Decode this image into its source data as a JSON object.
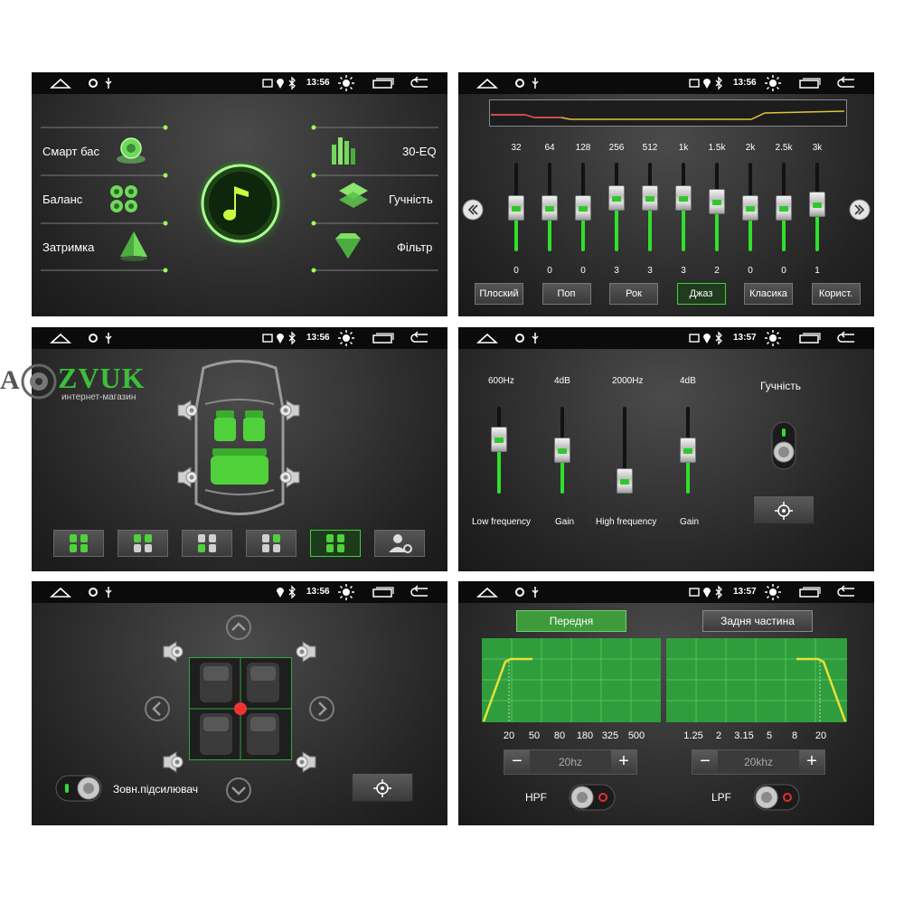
{
  "watermark": {
    "brand": "AVZVUK",
    "brand_prefix": "A",
    "brand_rest": "ZVUK",
    "subtitle": "интернет-магазин"
  },
  "status": {
    "p1_time": "13:56",
    "p2_time": "13:56",
    "p3_time": "13:56",
    "p4_time": "13:57",
    "p5_time": "13:56",
    "p6_time": "13:57"
  },
  "p1": {
    "smart_bass": "Смарт бас",
    "balance": "Баланс",
    "delay": "Затримка",
    "eq30": "30-EQ",
    "volume": "Гучність",
    "filter": "Фільтр"
  },
  "p2": {
    "bands": [
      "32",
      "64",
      "128",
      "256",
      "512",
      "1k",
      "1.5k",
      "2k",
      "2.5k",
      "3k"
    ],
    "values": [
      0,
      0,
      0,
      3,
      3,
      3,
      2,
      0,
      0,
      1
    ],
    "presets": [
      "Плоский",
      "Поп",
      "Рок",
      "Джаз",
      "Класика",
      "Корист."
    ],
    "active_preset": "Джаз",
    "prev_icon": "chevron-left-double-icon",
    "next_icon": "chevron-right-double-icon"
  },
  "p3": {
    "seat_modes": [
      "all-seats",
      "front-seats",
      "rear-left",
      "front-left",
      "driver",
      "custom"
    ],
    "active_mode": 4
  },
  "p4": {
    "freq1": "600Hz",
    "gain1": "4dB",
    "freq2": "2000Hz",
    "gain2": "4dB",
    "low_freq_label": "Low frequency",
    "gain_label_1": "Gain",
    "high_freq_label": "High frequency",
    "gain_label_2": "Gain",
    "volume_label": "Гучність",
    "levels": [
      0.62,
      0.5,
      0.12,
      0.5
    ]
  },
  "p5": {
    "subwoofer_label": "Зовн.підсилювач"
  },
  "p6": {
    "front_tab": "Передня",
    "rear_tab": "Задня частина",
    "hpf_ticks": [
      "20",
      "50",
      "80",
      "180",
      "325",
      "500"
    ],
    "lpf_ticks": [
      "1.25",
      "2",
      "3.15",
      "5",
      "8",
      "20"
    ],
    "hpf_value": "20hz",
    "lpf_value": "20khz",
    "minus": "−",
    "plus": "+",
    "hpf_label": "HPF",
    "lpf_label": "LPF"
  },
  "colors": {
    "accent": "#3fcf32",
    "active_border": "#3ed23a",
    "curve": "#e6e23a",
    "grid_green": "#2f9d3c"
  }
}
